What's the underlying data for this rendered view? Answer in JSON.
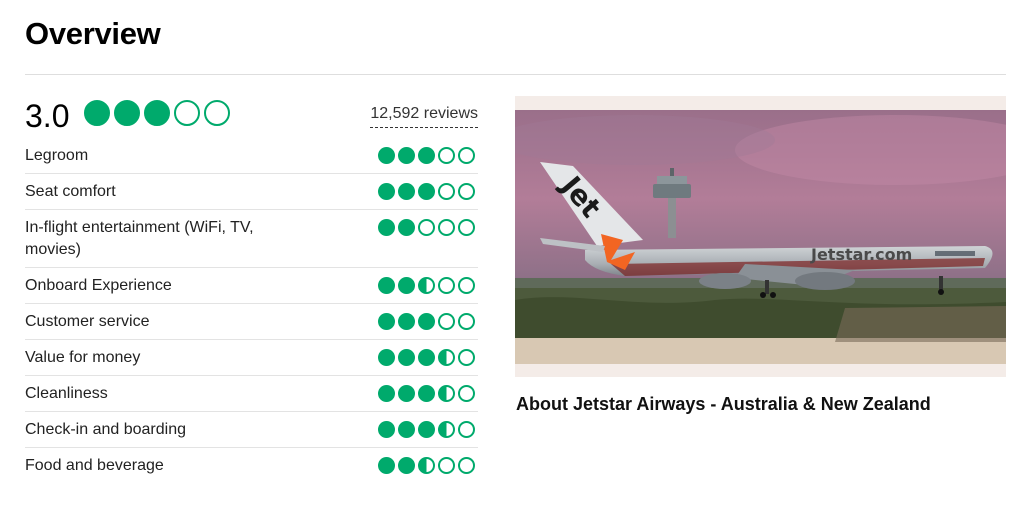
{
  "header": {
    "title": "Overview"
  },
  "summary": {
    "score": "3.0",
    "bubbles": 3,
    "reviews": "12,592 reviews"
  },
  "ratings": [
    {
      "label": "Legroom",
      "value": 3.0
    },
    {
      "label": "Seat comfort",
      "value": 3.0
    },
    {
      "label": "In-flight entertainment (WiFi, TV, movies)",
      "value": 2.0
    },
    {
      "label": "Onboard Experience",
      "value": 2.5
    },
    {
      "label": "Customer service",
      "value": 3.0
    },
    {
      "label": "Value for money",
      "value": 3.5
    },
    {
      "label": "Cleanliness",
      "value": 3.5
    },
    {
      "label": "Check-in and boarding",
      "value": 3.5
    },
    {
      "label": "Food and beverage",
      "value": 2.5
    }
  ],
  "photo": {
    "tail_text": "Jet",
    "fuselage_text": "Jetstar.com"
  },
  "about": {
    "title": "About Jetstar Airways - Australia & New Zealand"
  },
  "colors": {
    "accent": "#00aa6c",
    "brand_orange": "#f26522"
  }
}
